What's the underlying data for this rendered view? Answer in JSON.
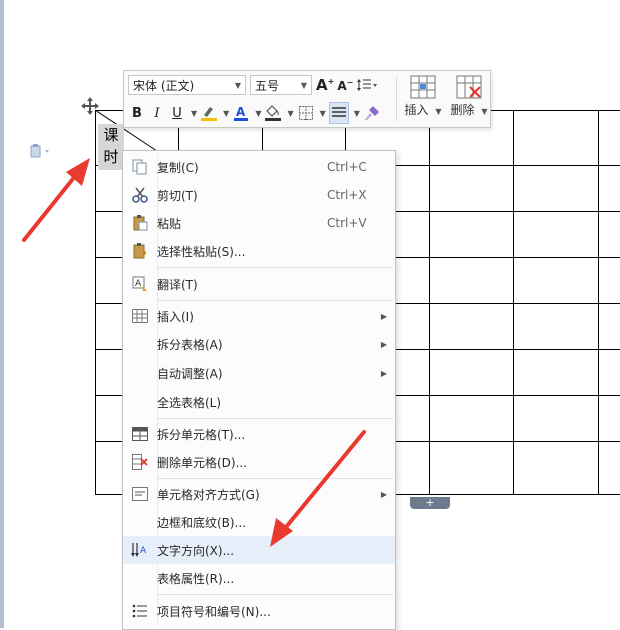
{
  "document": {
    "cell_text": "课\n时"
  },
  "toolbar": {
    "font_name": "宋体 (正文)",
    "font_size": "五号",
    "insert_label": "插入",
    "delete_label": "删除",
    "bold_label": "B",
    "italic_label": "I",
    "underline_label": "U"
  },
  "context_menu": {
    "items": [
      {
        "label": "复制(C)",
        "shortcut": "Ctrl+C",
        "icon": "copy-icon"
      },
      {
        "label": "剪切(T)",
        "shortcut": "Ctrl+X",
        "icon": "scissors-icon"
      },
      {
        "label": "粘贴",
        "shortcut": "Ctrl+V",
        "icon": "paste-icon"
      },
      {
        "label": "选择性粘贴(S)...",
        "shortcut": "",
        "icon": "paste-special-icon"
      },
      {
        "label": "翻译(T)",
        "shortcut": "",
        "icon": "translate-icon"
      },
      {
        "label": "插入(I)",
        "shortcut": "",
        "icon": "table-insert-icon",
        "submenu": true
      },
      {
        "label": "拆分表格(A)",
        "shortcut": "",
        "icon": "",
        "submenu": true
      },
      {
        "label": "自动调整(A)",
        "shortcut": "",
        "icon": "",
        "submenu": true
      },
      {
        "label": "全选表格(L)",
        "shortcut": "",
        "icon": ""
      },
      {
        "label": "拆分单元格(T)...",
        "shortcut": "",
        "icon": "split-cells-icon"
      },
      {
        "label": "删除单元格(D)...",
        "shortcut": "",
        "icon": "delete-cells-icon"
      },
      {
        "label": "单元格对齐方式(G)",
        "shortcut": "",
        "icon": "cell-align-icon",
        "submenu": true
      },
      {
        "label": "边框和底纹(B)...",
        "shortcut": "",
        "icon": ""
      },
      {
        "label": "文字方向(X)...",
        "shortcut": "",
        "icon": "text-direction-icon",
        "highlighted": true
      },
      {
        "label": "表格属性(R)...",
        "shortcut": "",
        "icon": ""
      },
      {
        "label": "项目符号和编号(N)...",
        "shortcut": "",
        "icon": "bullets-icon"
      }
    ]
  },
  "colors": {
    "arrow": "#e83a2e",
    "highlight_color": "#f2c200",
    "font_color": "#1e4fd6",
    "menu_hover": "#e6eef9"
  }
}
